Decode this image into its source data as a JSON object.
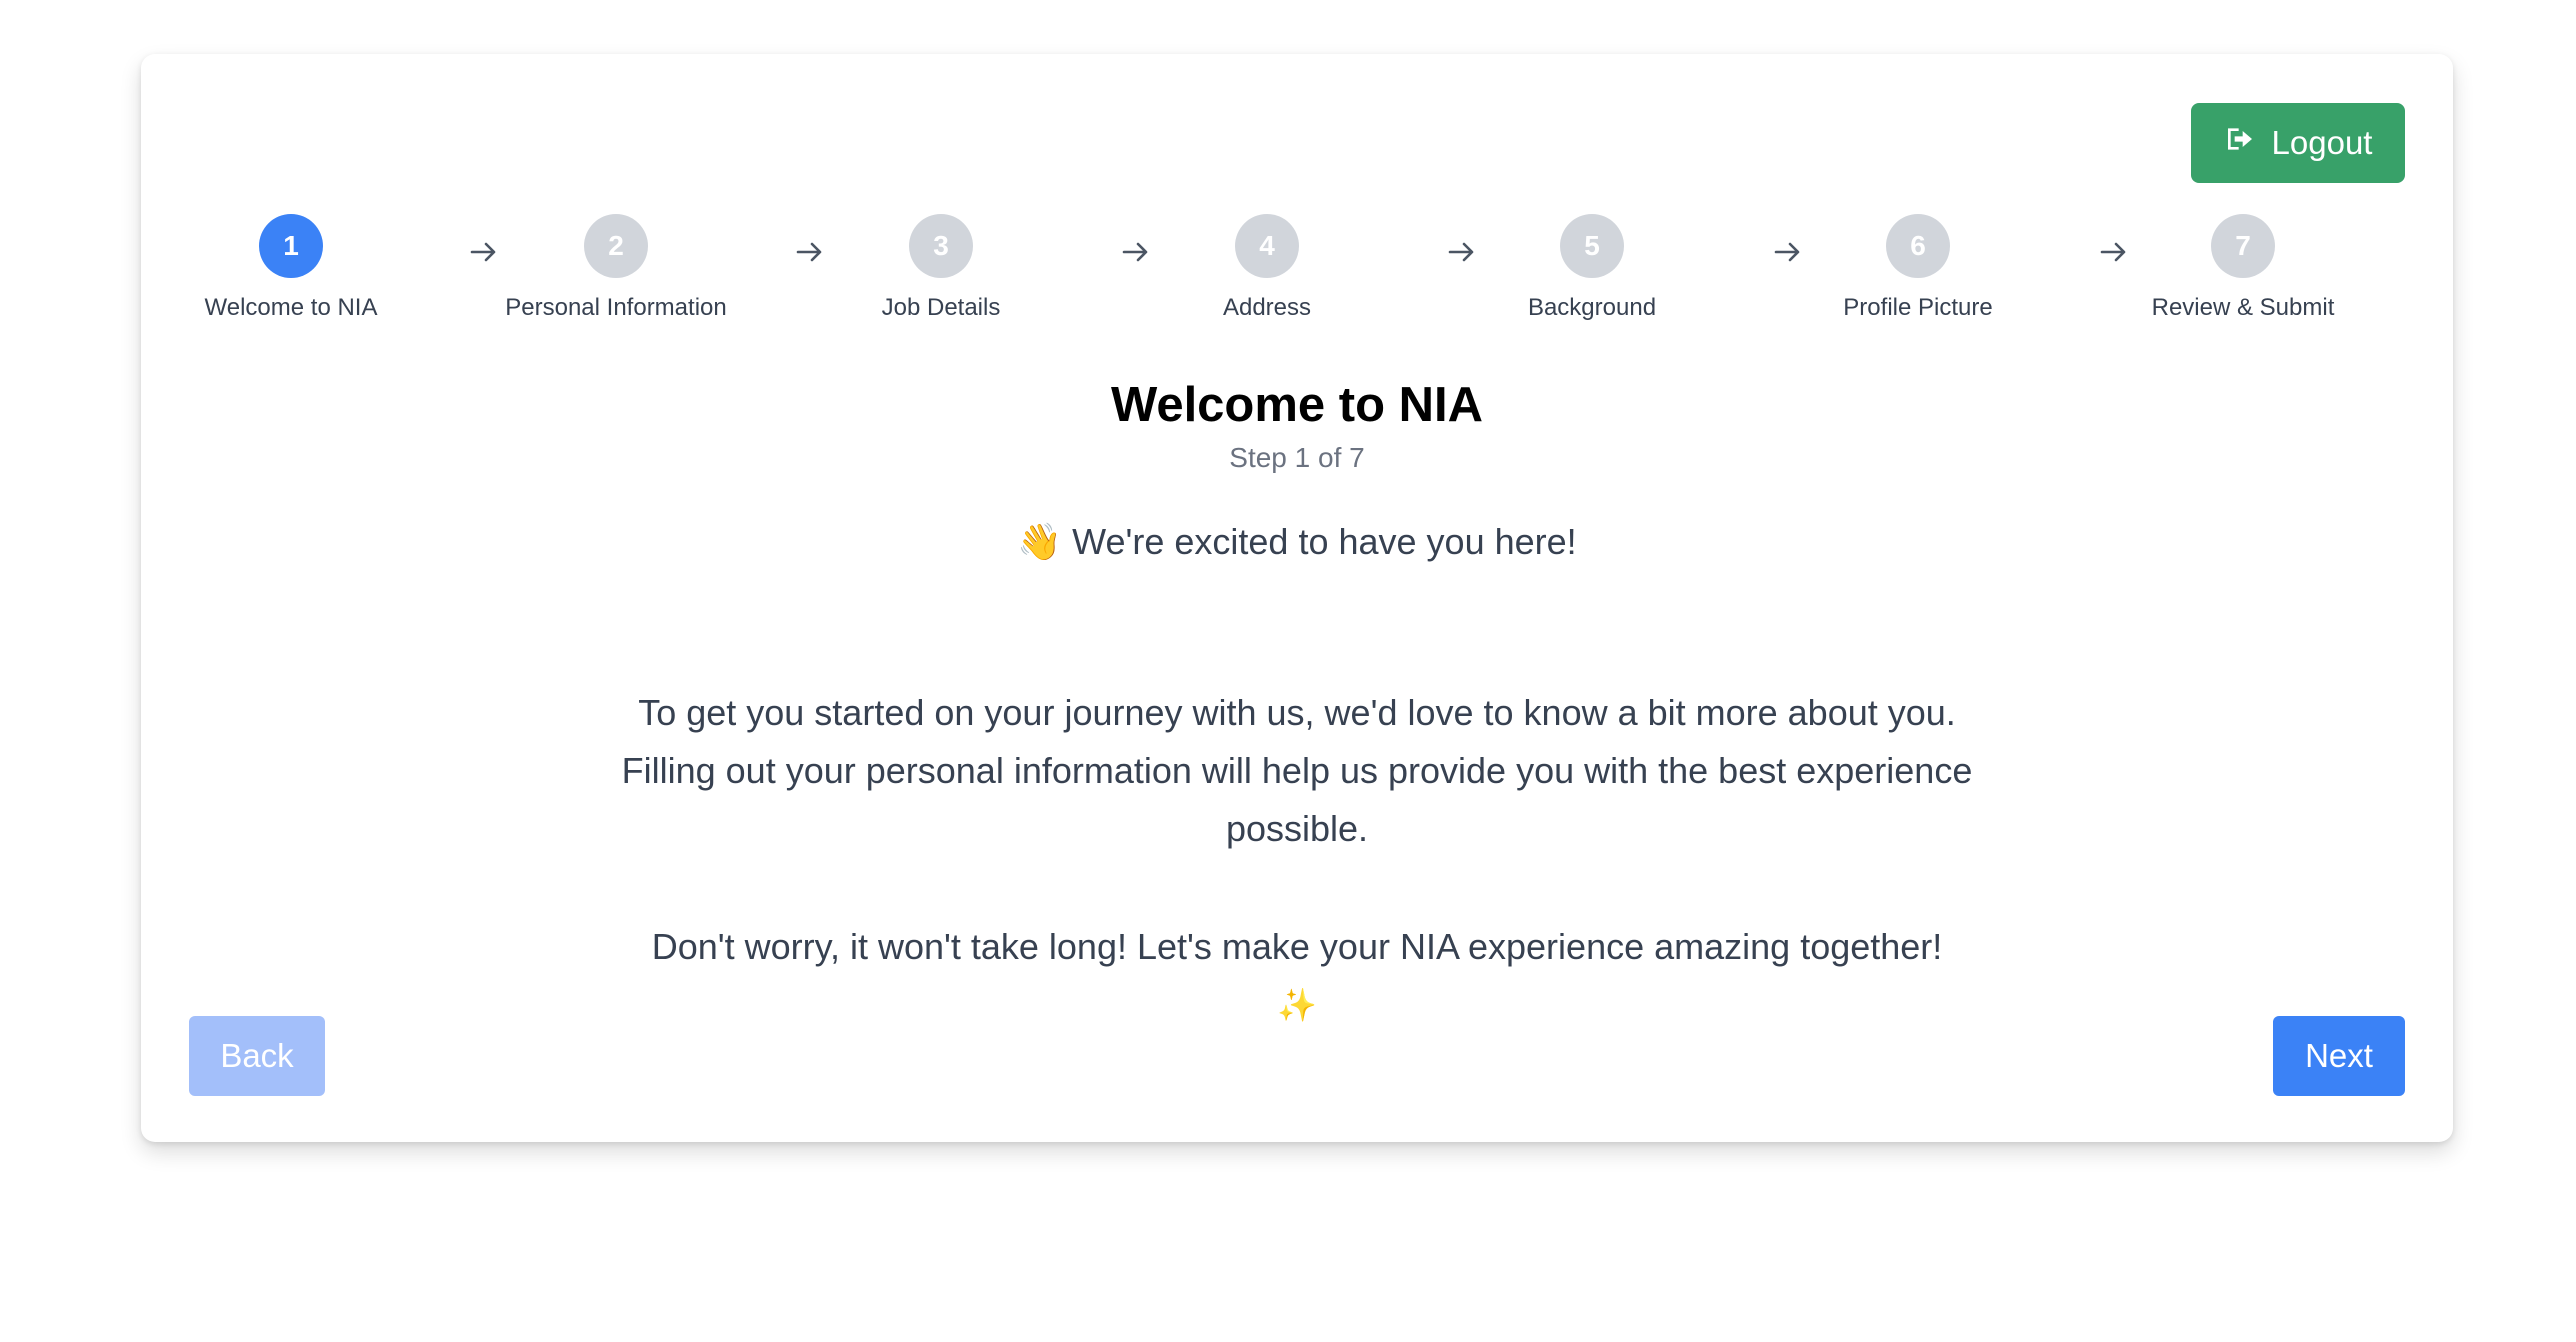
{
  "header": {
    "logout_label": "Logout",
    "logout_icon": "sign-out-icon"
  },
  "colors": {
    "primary": "#3b82f6",
    "success": "#38a169",
    "inactive_step": "#d1d5db",
    "disabled_primary": "#a3bffa"
  },
  "stepper": {
    "current_step": 1,
    "steps": [
      {
        "number": "1",
        "label": "Welcome to NIA"
      },
      {
        "number": "2",
        "label": "Personal Information"
      },
      {
        "number": "3",
        "label": "Job Details"
      },
      {
        "number": "4",
        "label": "Address"
      },
      {
        "number": "5",
        "label": "Background"
      },
      {
        "number": "6",
        "label": "Profile Picture"
      },
      {
        "number": "7",
        "label": "Review & Submit"
      }
    ]
  },
  "main": {
    "title": "Welcome to NIA",
    "subtitle": "Step 1 of 7",
    "greeting": "👋 We're excited to have you here!",
    "paragraph1": "To get you started on your journey with us, we'd love to know a bit more about you. Filling out your personal information will help us provide you with the best experience possible.",
    "paragraph2": "Don't worry, it won't take long! Let's make your NIA experience amazing together!",
    "sparkle": "✨"
  },
  "footer": {
    "back_label": "Back",
    "next_label": "Next"
  }
}
